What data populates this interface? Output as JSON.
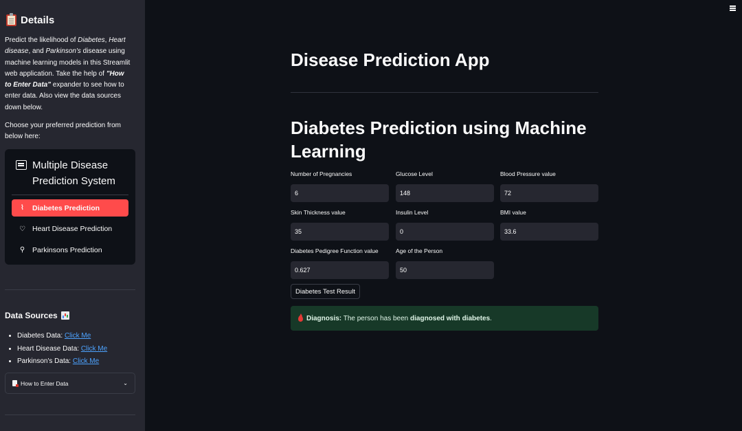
{
  "sidebar": {
    "title": "Details",
    "description_parts": [
      {
        "t": "Predict the likelihood of "
      },
      {
        "t": "Diabetes",
        "i": true
      },
      {
        "t": ", "
      },
      {
        "t": "Heart disease",
        "i": true
      },
      {
        "t": ", and "
      },
      {
        "t": "Parkinson's",
        "i": true
      },
      {
        "t": " disease using machine learning models in this Streamlit web application. Take the help of "
      },
      {
        "t": "\"How to Enter Data\"",
        "i": true,
        "b": true
      },
      {
        "t": " expander to see how to enter data. Also view the data sources down below."
      }
    ],
    "choose_text": "Choose your preferred prediction from below here:",
    "menu": {
      "title": "Multiple Disease Prediction System",
      "items": [
        {
          "label": "Diabetes Prediction",
          "icon": "activity-icon",
          "glyph": "⌇",
          "active": true
        },
        {
          "label": "Heart Disease Prediction",
          "icon": "heart-icon",
          "glyph": "♡",
          "active": false
        },
        {
          "label": "Parkinsons Prediction",
          "icon": "person-icon",
          "glyph": "⚲",
          "active": false
        }
      ]
    },
    "data_sources": {
      "title": "Data Sources",
      "items": [
        {
          "prefix": "Diabetes Data: ",
          "link": "Click Me"
        },
        {
          "prefix": "Heart Disease Data: ",
          "link": "Click Me"
        },
        {
          "prefix": "Parkinson's Data: ",
          "link": "Click Me"
        }
      ]
    },
    "expander_label": "How to Enter Data"
  },
  "main": {
    "app_title": "Disease Prediction App",
    "section_title": "Diabetes Prediction using Machine Learning",
    "fields": [
      {
        "label": "Number of Pregnancies",
        "value": "6"
      },
      {
        "label": "Glucose Level",
        "value": "148"
      },
      {
        "label": "Blood Pressure value",
        "value": "72"
      },
      {
        "label": "Skin Thickness value",
        "value": "35"
      },
      {
        "label": "Insulin Level",
        "value": "0"
      },
      {
        "label": "BMI value",
        "value": "33.6"
      },
      {
        "label": "Diabetes Pedigree Function value",
        "value": "0.627"
      },
      {
        "label": "Age of the Person",
        "value": "50"
      }
    ],
    "button_label": "Diabetes Test Result",
    "result": {
      "label": "Diagnosis:",
      "text_before": " The person has been ",
      "text_bold": "diagnosed with diabetes",
      "text_after": "."
    }
  },
  "colors": {
    "accent": "#ff4b4b",
    "success_bg": "#173928",
    "sidebar_bg": "#262730",
    "main_bg": "#0e1117",
    "link": "#4da3ff"
  }
}
